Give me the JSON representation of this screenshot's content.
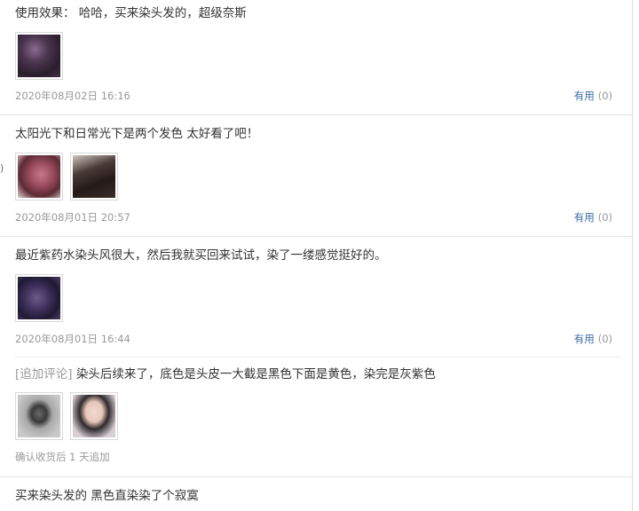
{
  "reviews": [
    {
      "text_label": "使用效果：",
      "text": " 哈哈，买来染头发的，超级奈斯",
      "images": [
        "hair-photo"
      ],
      "date": "2020年08月02日 16:16",
      "useful_label": "有用",
      "useful_count": "(0)"
    },
    {
      "text": "太阳光下和日常光下是两个发色 太好看了吧！",
      "images": [
        "hair-photo-sunlight",
        "hair-photo-indoor"
      ],
      "date": "2020年08月01日 20:57",
      "useful_label": "有用",
      "useful_count": "(0)"
    },
    {
      "text": "最近紫药水染头风很大，然后我就买回来试试，染了一缕感觉挺好的。",
      "images": [
        "hair-photo-purple"
      ],
      "date": "2020年08月01日 16:44",
      "useful_label": "有用",
      "useful_count": "(0)",
      "append": {
        "tag": "[追加评论]",
        "text": " 染头后续来了，底色是头皮一大截是黑色下面是黄色，染完是灰紫色",
        "images": [
          "hair-photo-followup-1",
          "hair-photo-followup-2"
        ],
        "meta": "确认收货后 1 天追加"
      }
    },
    {
      "text": "买来染头发的 黑色直染染了个寂寞"
    }
  ],
  "edge_mark": ")",
  "colors": {
    "link": "#3a6ea5",
    "muted": "#999999",
    "text": "#333333",
    "divider": "#e3e3e3"
  }
}
